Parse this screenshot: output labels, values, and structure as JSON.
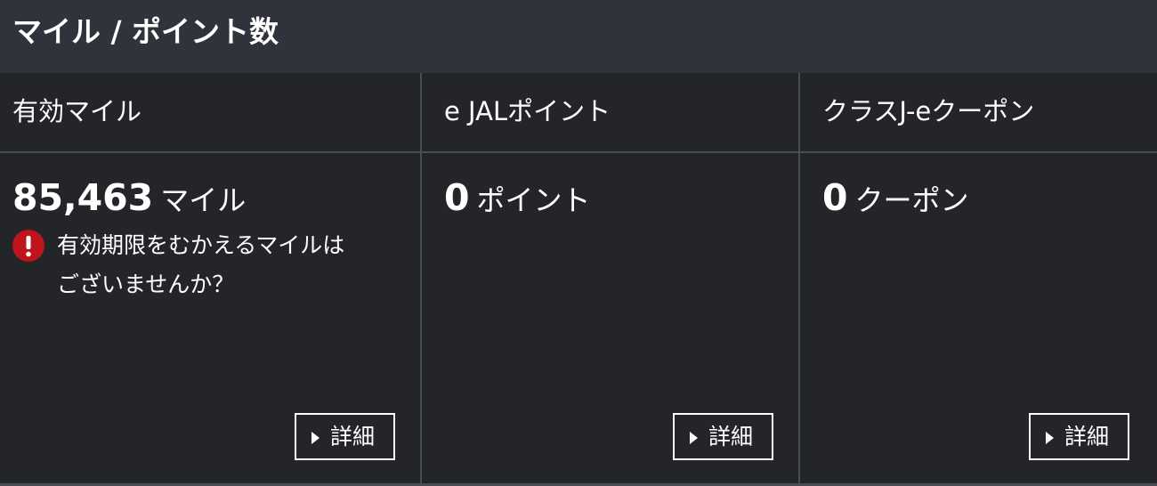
{
  "header": {
    "title": "マイル / ポイント数"
  },
  "columns": [
    {
      "heading": "有効マイル",
      "value": "85,463",
      "unit": "マイル",
      "notice": {
        "line1": "有効期限をむかえるマイルは",
        "line2": "ございませんか？"
      },
      "detail_label": "詳細"
    },
    {
      "heading": "e JALポイント",
      "value": "0",
      "unit": "ポイント",
      "detail_label": "詳細"
    },
    {
      "heading": "クラスJ-eクーポン",
      "value": "0",
      "unit": "クーポン",
      "detail_label": "詳細"
    }
  ],
  "colors": {
    "background": "#232529",
    "header_bg": "#30333c",
    "divider": "#4a4d55",
    "alert": "#c0141c"
  },
  "icons": {
    "alert": "exclamation-circle-icon",
    "button_arrow": "triangle-right-icon"
  }
}
